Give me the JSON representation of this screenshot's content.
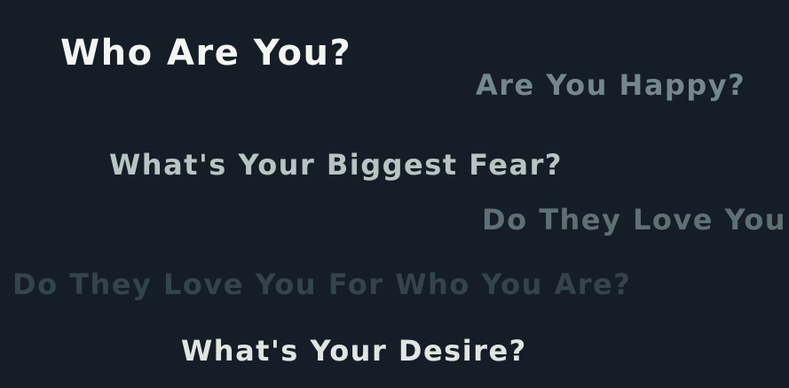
{
  "scene": {
    "background_color": "#151d27",
    "questions": [
      {
        "text": "Who Are You?",
        "color": "#f3f5f2"
      },
      {
        "text": "Are You Happy?",
        "color": "#74878c"
      },
      {
        "text": "What's Your Biggest Fear?",
        "color": "#b6c4c2"
      },
      {
        "text": "Do They Love You",
        "color": "#5f7074"
      },
      {
        "text": "Do They Love You For Who You Are?",
        "color": "#34444a"
      },
      {
        "text": "What's Your Desire?",
        "color": "#dfe6e2"
      }
    ]
  }
}
